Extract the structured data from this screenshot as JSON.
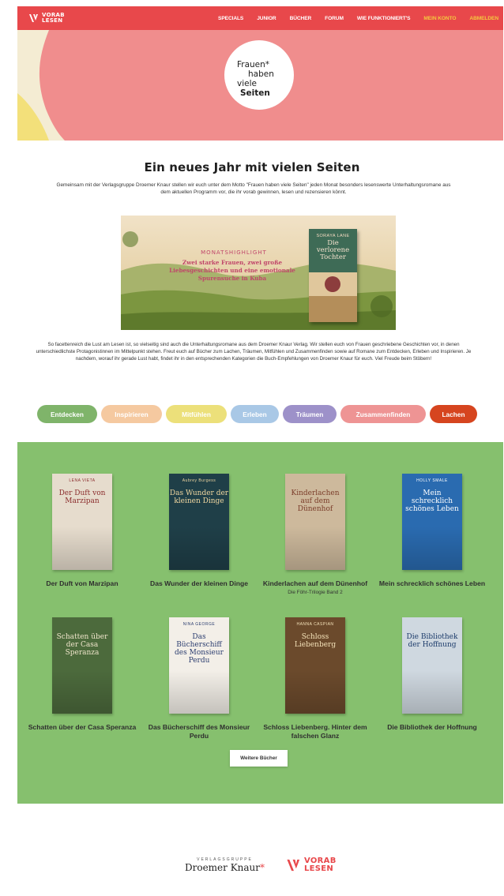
{
  "brand": {
    "name": "VORAB LESEN",
    "name_line1": "VORAB",
    "name_line2": "LESEN",
    "color": "#e8484b"
  },
  "nav": {
    "items": [
      {
        "label": "SPECIALS",
        "accent": false
      },
      {
        "label": "JUNIOR",
        "accent": false
      },
      {
        "label": "BÜCHER",
        "accent": false
      },
      {
        "label": "FORUM",
        "accent": false
      },
      {
        "label": "WIE FUNKTIONIERT'S",
        "accent": false
      },
      {
        "label": "MEIN KONTO",
        "accent": true
      },
      {
        "label": "ABMELDEN",
        "accent": true
      }
    ],
    "accent_color": "#f4c73f"
  },
  "hero": {
    "line1": "Frauen*",
    "line2": "haben",
    "line3": "viele",
    "line4": "Seiten",
    "background": "#f08d8d"
  },
  "main": {
    "headline": "Ein neues Jahr mit vielen Seiten",
    "intro": "Gemeinsam mit der Verlagsgruppe Droemer Knaur stellen wir euch unter dem Motto \"Frauen haben viele Seiten\" jeden Monat besonders lesenswerte Unterhaltungsromane aus dem aktuellen Programm vor, die ihr vorab gewinnen, lesen und rezensieren könnt.",
    "banner": {
      "kicker": "MONATSHIGHLIGHT",
      "text": "Zwei starke Frauen, zwei große Liebesgeschichten und eine emotionale Spurensuche in Kuba",
      "cover_author": "SORAYA LANE",
      "cover_title": "Die verlorene Tochter"
    },
    "description": "So facettenreich die Lust am Lesen ist, so vielseitig sind auch die Unterhaltungsromane aus dem Droemer Knaur Verlag. Wir stellen euch von Frauen geschriebene Geschichten vor, in denen unterschiedlichste Protagonistinnen im Mittelpunkt stehen. Freut euch auf Bücher zum Lachen, Träumen, Mitfühlen und Zusammenfinden sowie auf Romane zum Entdecken, Erleben und Inspirieren. Je nachdem, worauf ihr gerade Lust habt, findet ihr in den entsprechenden Kategorien die Buch-Empfehlungen von Droemer Knaur für euch. Viel Freude beim Stöbern!"
  },
  "categories": [
    {
      "label": "Entdecken",
      "color": "#7fb46a"
    },
    {
      "label": "Inspirieren",
      "color": "#f5c9a0"
    },
    {
      "label": "Mitfühlen",
      "color": "#ece07a"
    },
    {
      "label": "Erleben",
      "color": "#a9c8e6"
    },
    {
      "label": "Träumen",
      "color": "#9d91c9"
    },
    {
      "label": "Zusammenfinden",
      "color": "#ee9494"
    },
    {
      "label": "Lachen",
      "color": "#d6451f"
    }
  ],
  "books": [
    {
      "title": "Der Duft von Marzipan",
      "subtitle": "",
      "cover_author": "LENA VIETA",
      "cover_title": "Der Duft von Marzipan",
      "cover_color": "#e6dccd",
      "text_color": "#8b2d2d"
    },
    {
      "title": "Das Wunder der kleinen Dinge",
      "subtitle": "",
      "cover_author": "Aubrey Burgess",
      "cover_title": "Das Wunder der kleinen Dinge",
      "cover_color": "#1f3f48",
      "text_color": "#f0d7a0"
    },
    {
      "title": "Kinderlachen auf dem Dünenhof",
      "subtitle": "Die Föhr-Trilogie Band 2",
      "cover_author": "",
      "cover_title": "Kinderlachen auf dem Dünenhof",
      "cover_color": "#cdb99c",
      "text_color": "#7b3d2a"
    },
    {
      "title": "Mein schrecklich schönes Leben",
      "subtitle": "",
      "cover_author": "HOLLY SMALE",
      "cover_title": "Mein schrecklich schönes Leben",
      "cover_color": "#2a6bb0",
      "text_color": "#ffffff"
    },
    {
      "title": "Schatten über der Casa Speranza",
      "subtitle": "",
      "cover_author": "",
      "cover_title": "Schatten über der Casa Speranza",
      "cover_color": "#4c6a3c",
      "text_color": "#f1e6cc"
    },
    {
      "title": "Das Bücherschiff des Monsieur Perdu",
      "subtitle": "",
      "cover_author": "NINA GEORGE",
      "cover_title": "Das Bücherschiff des Monsieur Perdu",
      "cover_color": "#f3efe8",
      "text_color": "#2c3e70"
    },
    {
      "title": "Schloss Liebenberg. Hinter dem falschen Glanz",
      "subtitle": "",
      "cover_author": "HANNA CASPIAN",
      "cover_title": "Schloss Liebenberg",
      "cover_color": "#6b4a2c",
      "text_color": "#f3e1b8"
    },
    {
      "title": "Die Bibliothek der Hoffnung",
      "subtitle": "",
      "cover_author": "",
      "cover_title": "Die Bibliothek der Hoffnung",
      "cover_color": "#cfd8e0",
      "text_color": "#1d3c6b"
    }
  ],
  "more_button": "Weitere Bücher",
  "footer": {
    "publisher_kicker": "VERLAGSGRUPPE",
    "publisher_name": "Droemer Knaur",
    "publisher_star": "*"
  }
}
